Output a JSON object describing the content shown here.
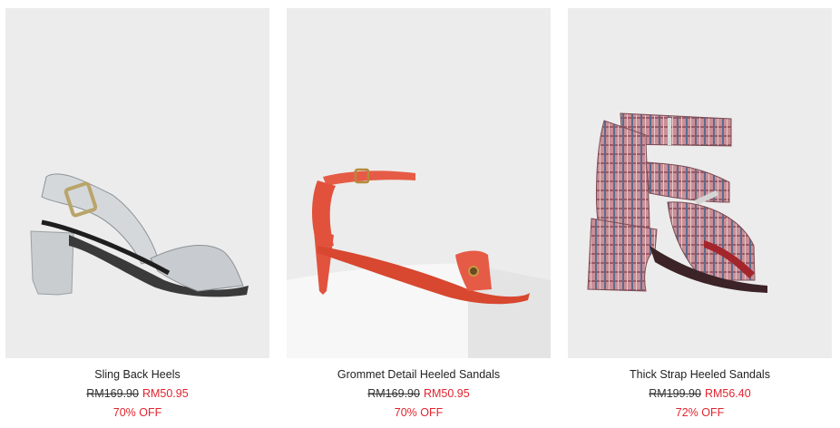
{
  "products": [
    {
      "name": "Sling Back Heels",
      "original_price": "RM169.90",
      "sale_price": "RM50.95",
      "discount": "70% OFF",
      "image_icon": "sling-back-heel-image"
    },
    {
      "name": "Grommet Detail Heeled Sandals",
      "original_price": "RM169.90",
      "sale_price": "RM50.95",
      "discount": "70% OFF",
      "image_icon": "grommet-sandal-image"
    },
    {
      "name": "Thick Strap Heeled Sandals",
      "original_price": "RM199.90",
      "sale_price": "RM56.40",
      "discount": "72% OFF",
      "image_icon": "thick-strap-sandal-image"
    }
  ],
  "colors": {
    "image_bg": "#ececec",
    "sale_red": "#e0242f",
    "text": "#222222"
  }
}
